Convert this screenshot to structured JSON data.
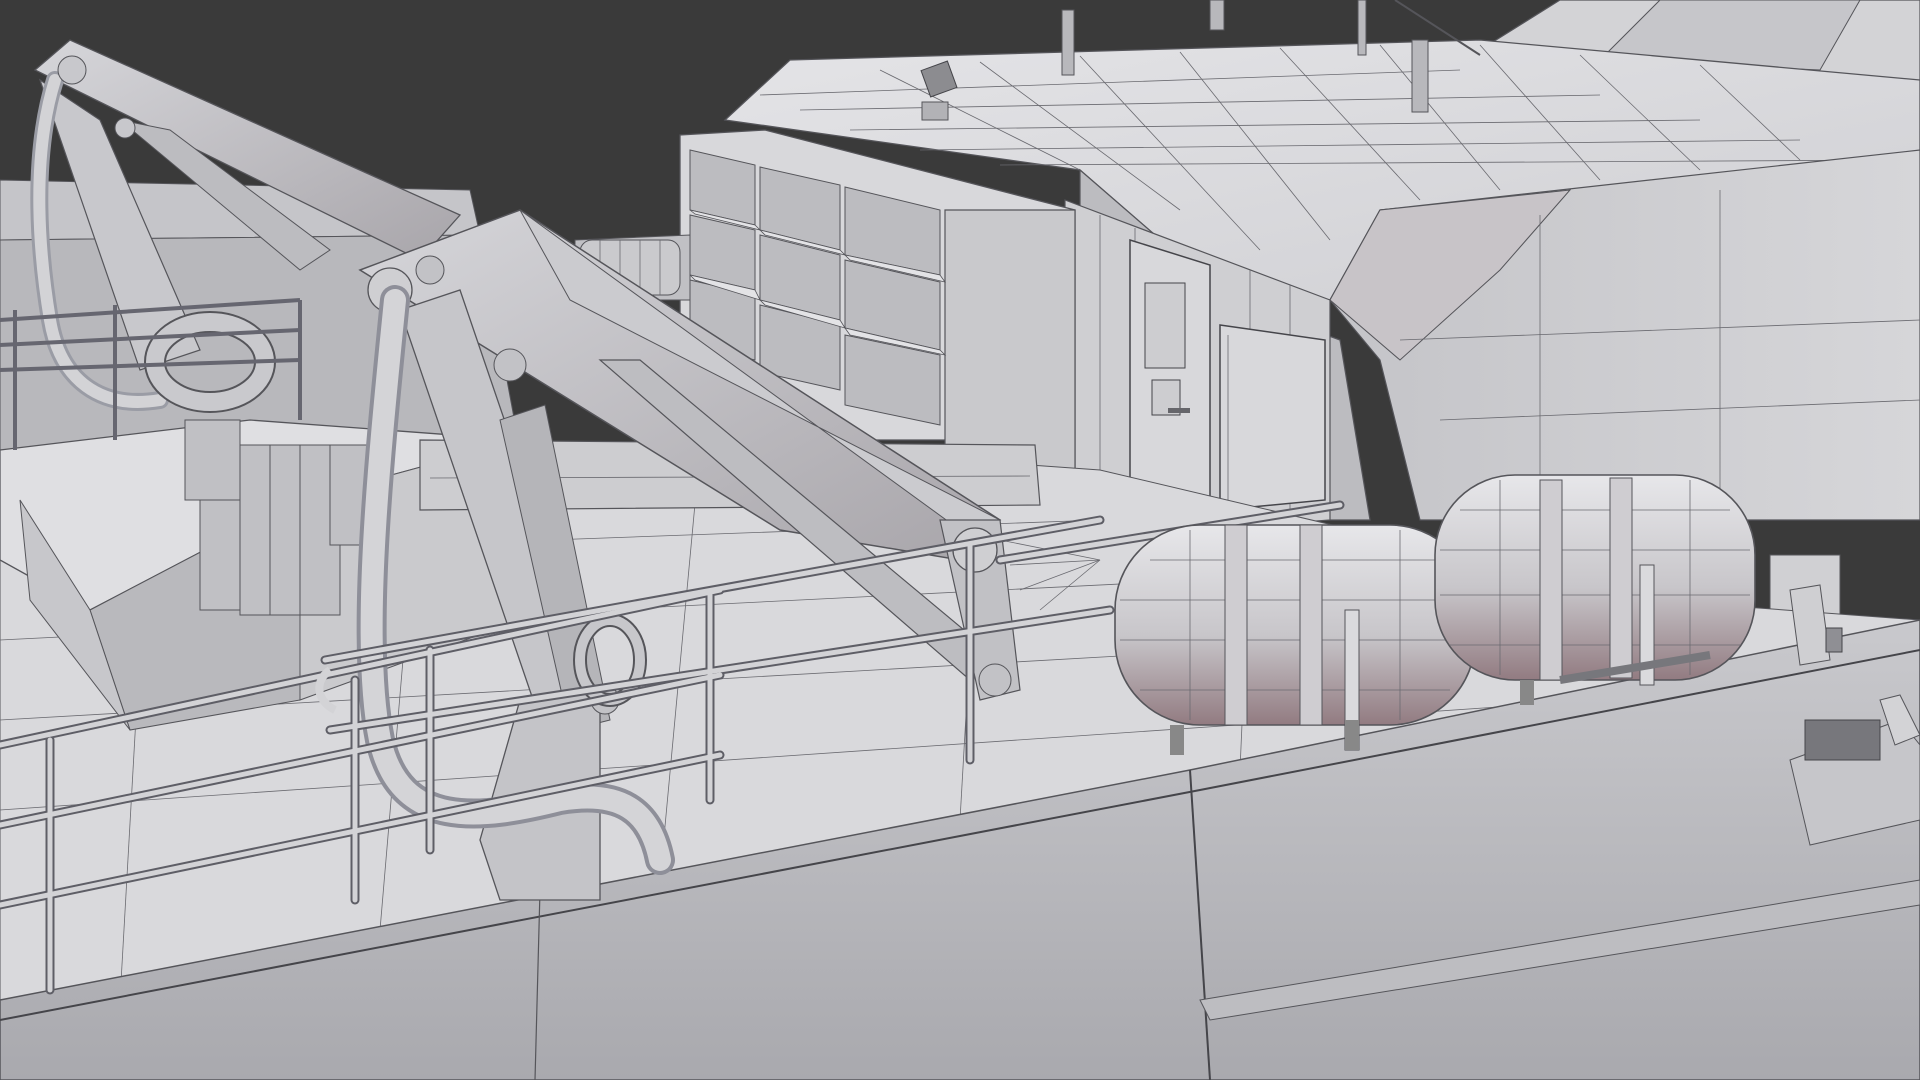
{
  "scene": {
    "description_colors": {
      "background": "#3a3a3a",
      "surface_light": "#d9d9dc",
      "surface_mid": "#bdbdc1",
      "surface_dark": "#8f8f94",
      "shadow_tint": "#8a6f74",
      "wire": "#55555a"
    },
    "objects": [
      "crane-arm-left",
      "crane-arm-front",
      "life-raft-canister-1",
      "life-raft-canister-2",
      "deck-railing",
      "deckhouse",
      "storage-shelves",
      "cabin-door",
      "hull-panel"
    ]
  }
}
